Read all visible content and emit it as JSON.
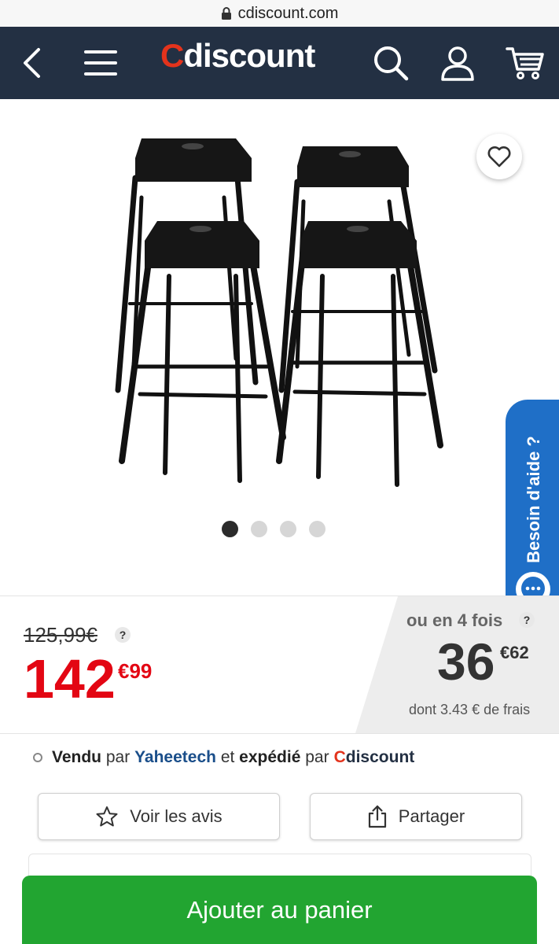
{
  "browser": {
    "url": "cdiscount.com"
  },
  "header": {
    "logo_c": "C",
    "logo_rest": "discount",
    "icons": [
      "back-arrow-icon",
      "menu-icon",
      "search-icon",
      "user-icon",
      "cart-icon"
    ],
    "colors": {
      "background": "#233043",
      "logo_accent": "#e3331c"
    }
  },
  "gallery": {
    "image_count": 4,
    "active_index": 0,
    "favorite_icon": "heart-icon"
  },
  "help": {
    "label": "Besoin d'aide ?",
    "icon": "chat-bubble-icon",
    "color": "#1f6fc7"
  },
  "pricing": {
    "old_price": "125,99€",
    "old_price_help": "?",
    "price_whole": "142",
    "price_cents": "€99",
    "installment_label": "ou en 4 fois",
    "installment_help": "?",
    "installment_whole": "36",
    "installment_cents": "€62",
    "installment_fees": "dont 3.43 € de frais",
    "price_color": "#e30613"
  },
  "seller": {
    "sold_label": "Vendu",
    "by1": "par",
    "seller_name": "Yaheetech",
    "and": "et",
    "shipped_label": "expédié",
    "by2": "par",
    "shipper_c": "C",
    "shipper_rest": "discount"
  },
  "actions": {
    "reviews_label": "Voir les avis",
    "share_label": "Partager"
  },
  "cta": {
    "label": "Ajouter au panier",
    "color": "#22a531"
  }
}
